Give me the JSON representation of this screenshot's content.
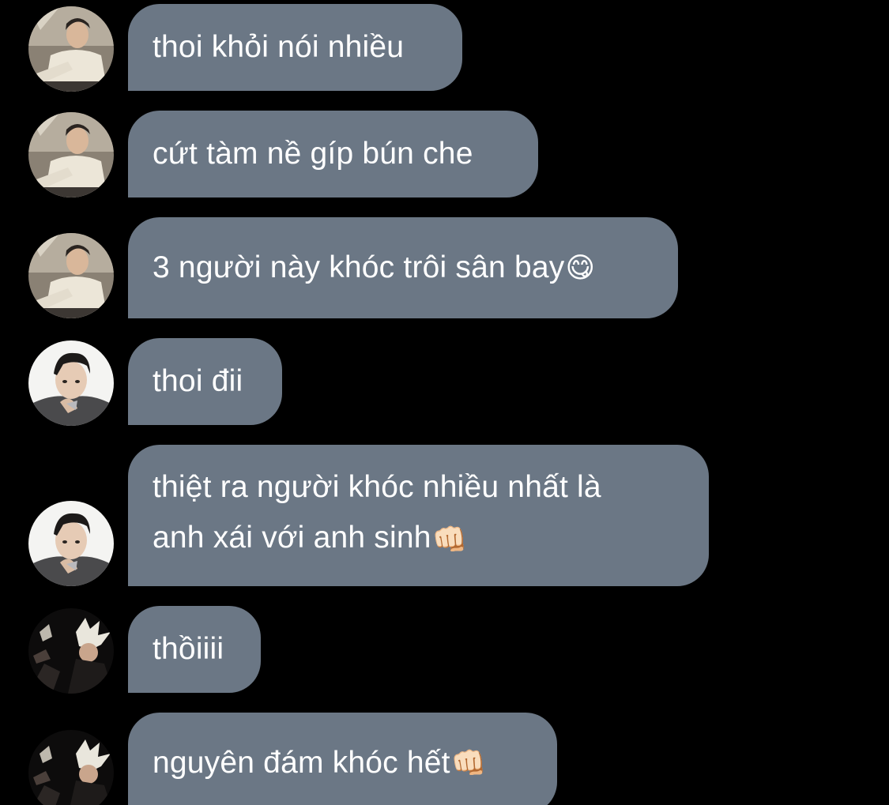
{
  "messages": [
    {
      "text": "thoi khỏi nói nhiều",
      "emoji": "",
      "avatar": "avatar-man-white-sweater"
    },
    {
      "text": "cứt tàm nề gíp bún che",
      "emoji": "",
      "avatar": "avatar-man-white-sweater"
    },
    {
      "text": "3 người này khóc trôi sân bay",
      "emoji": "😋",
      "avatar": "avatar-man-white-sweater"
    },
    {
      "text": "thoi đii",
      "emoji": "",
      "avatar": "avatar-man-dark-suit"
    },
    {
      "line1": "thiệt ra người khóc nhiều nhất là",
      "line2": "anh xái với anh sinh",
      "emoji": "👊🏻",
      "avatar": "avatar-man-dark-suit"
    },
    {
      "text": "thồiiii",
      "emoji": "",
      "avatar": "avatar-blond-hair"
    },
    {
      "text": "nguyên đám khóc hết",
      "emoji": "👊🏻",
      "avatar": "avatar-blond-hair"
    }
  ],
  "colors": {
    "background": "#000000",
    "bubble": "#6b7785",
    "text": "#ffffff"
  }
}
